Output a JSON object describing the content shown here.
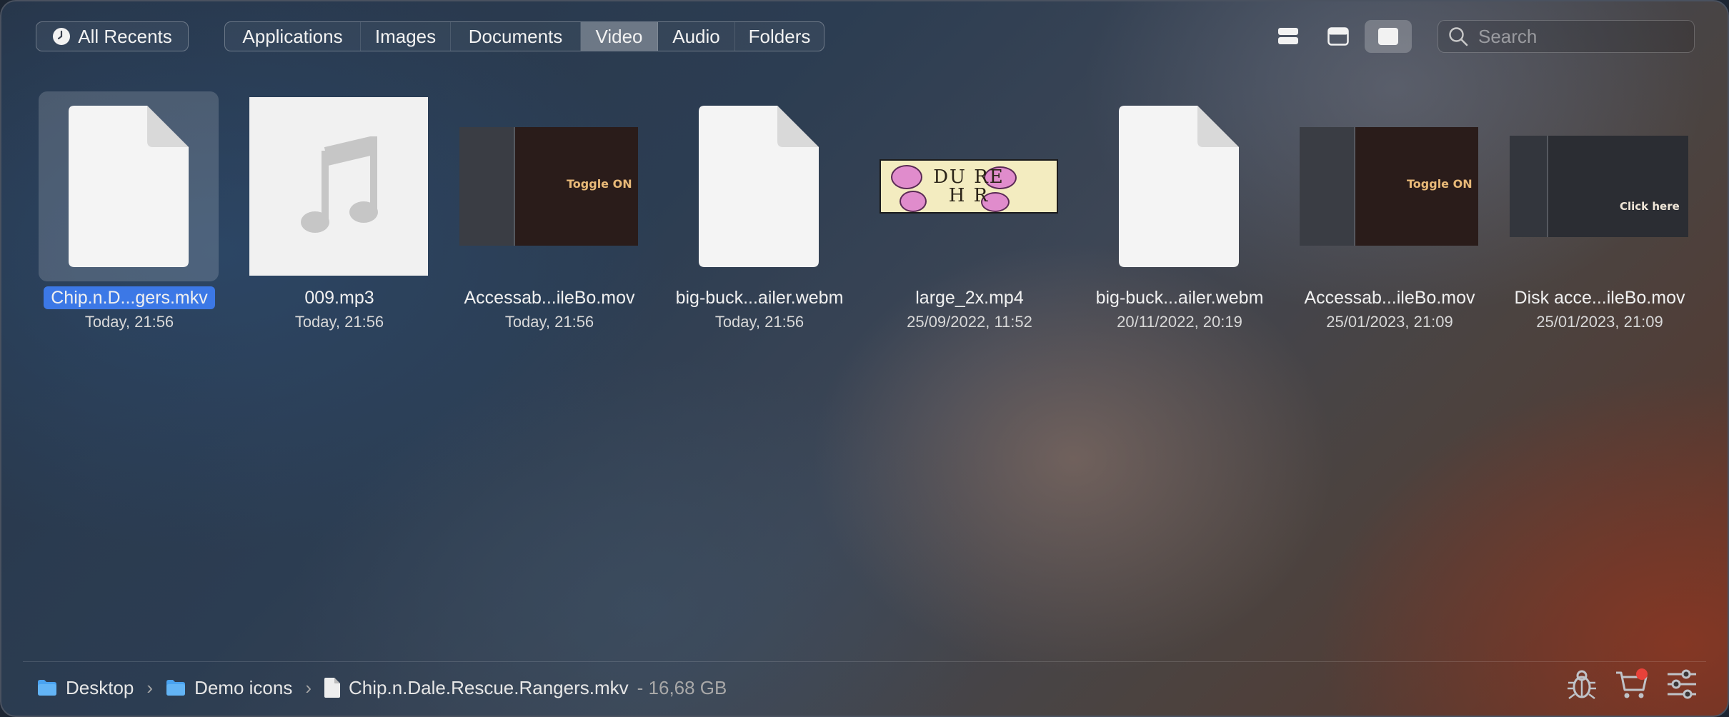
{
  "toolbar": {
    "recents_label": "All Recents",
    "categories": [
      "Applications",
      "Images",
      "Documents",
      "Video",
      "Audio",
      "Folders"
    ],
    "active_category": "Video",
    "search_placeholder": "Search"
  },
  "files": [
    {
      "name": "Chip.n.D...gers.mkv",
      "date": "Today, 21:56",
      "thumb": "generic-document-icon",
      "selected": true
    },
    {
      "name": "009.mp3",
      "date": "Today, 21:56",
      "thumb": "music-note-icon",
      "selected": false
    },
    {
      "name": "Accessab...ileBo.mov",
      "date": "Today, 21:56",
      "thumb": "screenshot-thumbnail",
      "callout": "Toggle ON",
      "selected": false
    },
    {
      "name": "big-buck...ailer.webm",
      "date": "Today, 21:56",
      "thumb": "generic-document-icon",
      "selected": false
    },
    {
      "name": "large_2x.mp4",
      "date": "25/09/2022, 11:52",
      "thumb": "banner-thumbnail",
      "banner_line1": "DU  RE",
      "banner_line2": "H  R",
      "selected": false
    },
    {
      "name": "big-buck...ailer.webm",
      "date": "20/11/2022, 20:19",
      "thumb": "generic-document-icon",
      "selected": false
    },
    {
      "name": "Accessab...ileBo.mov",
      "date": "25/01/2023, 21:09",
      "thumb": "screenshot-thumbnail",
      "callout": "Toggle ON",
      "selected": false
    },
    {
      "name": "Disk acce...ileBo.mov",
      "date": "25/01/2023, 21:09",
      "thumb": "screenshot-thumbnail",
      "callout": "Click here",
      "selected": false
    }
  ],
  "pathbar": {
    "crumbs": [
      "Desktop",
      "Demo icons",
      "Chip.n.Dale.Rescue.Rangers.mkv"
    ],
    "size": "- 16,68 GB"
  },
  "colors": {
    "selection": "#3c78e6",
    "folder": "#4aa3f0",
    "badge": "#e8423a"
  }
}
